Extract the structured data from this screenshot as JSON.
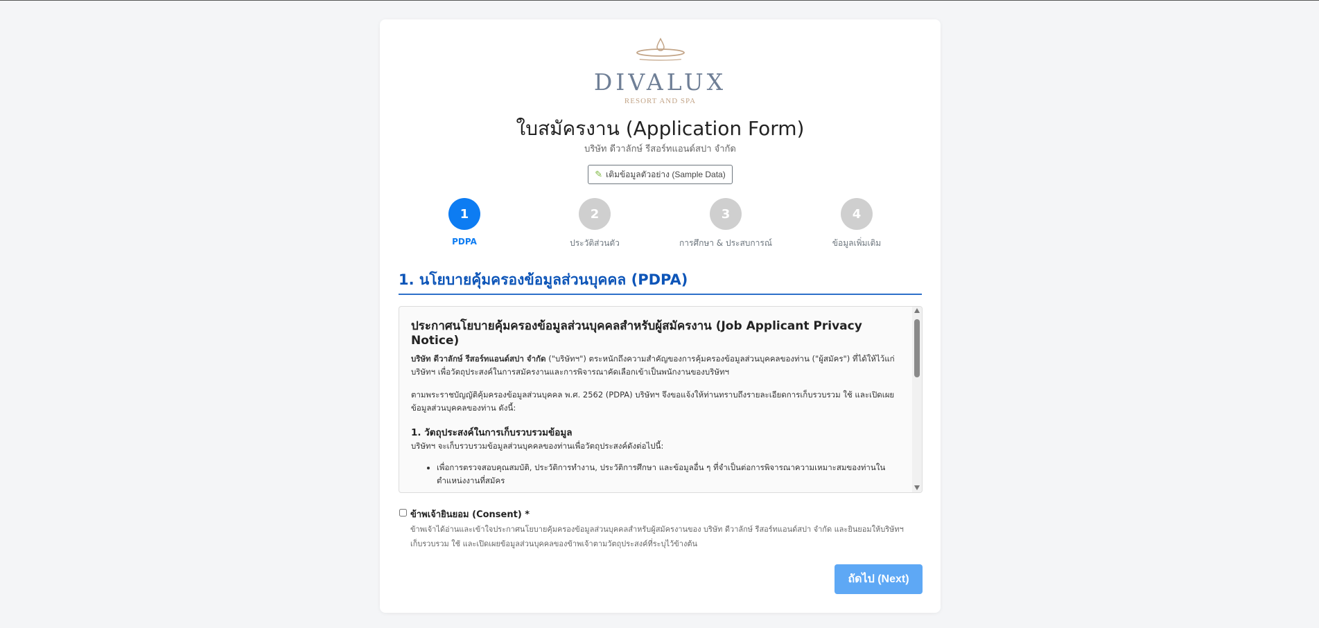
{
  "brand": {
    "name": "DIVALUX",
    "tagline": "RESORT AND SPA"
  },
  "header": {
    "title": "ใบสมัครงาน (Application Form)",
    "subtitle": "บริษัท ดีวาลักษ์ รีสอร์ทแอนด์สปา จำกัด",
    "sample_button": "เติมข้อมูลตัวอย่าง (Sample Data)"
  },
  "steps": [
    {
      "number": "1",
      "label": "PDPA",
      "active": true
    },
    {
      "number": "2",
      "label": "ประวัติส่วนตัว",
      "active": false
    },
    {
      "number": "3",
      "label": "การศึกษา & ประสบการณ์",
      "active": false
    },
    {
      "number": "4",
      "label": "ข้อมูลเพิ่มเติม",
      "active": false
    }
  ],
  "section": {
    "title": "1. นโยบายคุ้มครองข้อมูลส่วนบุคคล (PDPA)"
  },
  "notice": {
    "heading": "ประกาศนโยบายคุ้มครองข้อมูลส่วนบุคคลสำหรับผู้สมัครงาน (Job Applicant Privacy Notice)",
    "company_bold": "บริษัท ดีวาลักษ์ รีสอร์ทแอนด์สปา จำกัด",
    "intro": " (\"บริษัทฯ\") ตระหนักถึงความสำคัญของการคุ้มครองข้อมูลส่วนบุคคลของท่าน (\"ผู้สมัคร\") ที่ได้ให้ไว้แก่บริษัทฯ เพื่อวัตถุประสงค์ในการสมัครงานและการพิจารณาคัดเลือกเข้าเป็นพนักงานของบริษัทฯ",
    "law": "ตามพระราชบัญญัติคุ้มครองข้อมูลส่วนบุคคล พ.ศ. 2562 (PDPA) บริษัทฯ จึงขอแจ้งให้ท่านทราบถึงรายละเอียดการเก็บรวบรวม ใช้ และเปิดเผยข้อมูลส่วนบุคคลของท่าน ดังนี้:",
    "purpose_heading": "1. วัตถุประสงค์ในการเก็บรวบรวมข้อมูล",
    "purpose_intro": "บริษัทฯ จะเก็บรวบรวมข้อมูลส่วนบุคคลของท่านเพื่อวัตถุประสงค์ดังต่อไปนี้:",
    "purpose_items": [
      "เพื่อการตรวจสอบคุณสมบัติ, ประวัติการทำงาน, ประวัติการศึกษา และข้อมูลอื่น ๆ ที่จำเป็นต่อการพิจารณาความเหมาะสมของท่านในตำแหน่งงานที่สมัคร"
    ]
  },
  "consent": {
    "label": "ข้าพเจ้ายินยอม (Consent) *",
    "description": "ข้าพเจ้าได้อ่านและเข้าใจประกาศนโยบายคุ้มครองข้อมูลส่วนบุคคลสำหรับผู้สมัครงานของ บริษัท ดีวาลักษ์ รีสอร์ทแอนด์สปา จำกัด และยินยอมให้บริษัทฯ เก็บรวบรวม ใช้ และเปิดเผยข้อมูลส่วนบุคคลของข้าพเจ้าตามวัตถุประสงค์ที่ระบุไว้ข้างต้น"
  },
  "actions": {
    "next": "ถัดไป (Next)"
  },
  "colors": {
    "primary": "#0d7cf2",
    "section_title": "#0d55b8",
    "next_disabled": "#5ea8f5",
    "step_inactive": "#cfcfcf",
    "brand_text": "#6f7f96",
    "brand_gold": "#c2a487"
  }
}
